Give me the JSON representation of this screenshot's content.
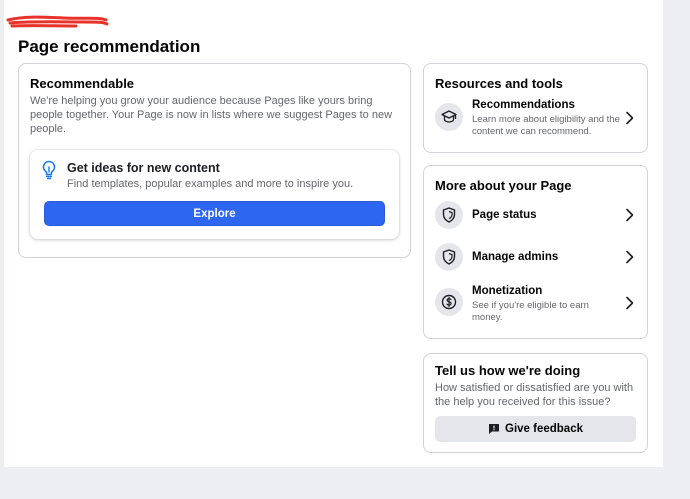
{
  "header": {
    "title": "Page recommendation"
  },
  "recommendable": {
    "title": "Recommendable",
    "description": "We're helping you grow your audience because Pages like yours bring people together. Your Page is now in lists where we suggest Pages to new people.",
    "ideas": {
      "icon": "lightbulb-icon",
      "title": "Get ideas for new content",
      "description": "Find templates, popular examples and more to inspire you.",
      "button_label": "Explore"
    }
  },
  "resources": {
    "title": "Resources and tools",
    "items": [
      {
        "icon": "graduation-cap-icon",
        "label": "Recommendations",
        "sub": "Learn more about eligibility and the content we can recommend."
      }
    ]
  },
  "more_about": {
    "title": "More about your Page",
    "items": [
      {
        "icon": "shield-icon",
        "label": "Page status",
        "sub": ""
      },
      {
        "icon": "shield-icon",
        "label": "Manage admins",
        "sub": ""
      },
      {
        "icon": "dollar-circle-icon",
        "label": "Monetization",
        "sub": "See if you're eligible to earn money."
      }
    ]
  },
  "feedback": {
    "title": "Tell us how we're doing",
    "description": "How satisfied or dissatisfied are you with the help you received for this issue?",
    "button_label": "Give feedback",
    "button_icon": "feedback-icon"
  },
  "colors": {
    "primary": "#2d66f0",
    "secondary_button": "#e4e6eb",
    "border": "#d0d3d8",
    "redaction": "#e8332a"
  }
}
